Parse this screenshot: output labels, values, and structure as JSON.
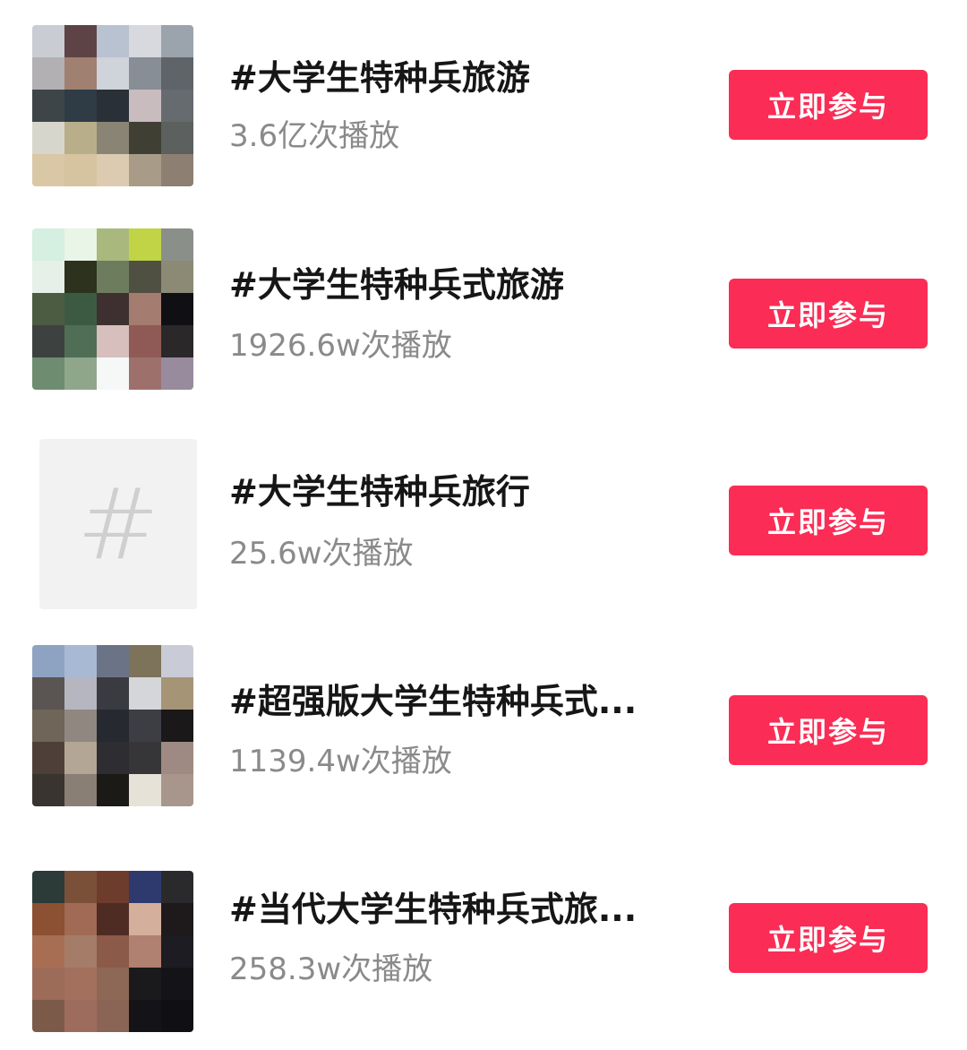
{
  "topics": [
    {
      "title": "#大学生特种兵旅游",
      "plays": "3.6亿次播放",
      "button_label": "立即参与",
      "thumb_type": "blurred-photo",
      "thumb_colors": [
        "#c9ccd3",
        "#5e4346",
        "#b9c2d0",
        "#d7d9df",
        "#9ba3ad",
        "#b2b0b3",
        "#a08070",
        "#cfd3da",
        "#878e95",
        "#5f6468",
        "#3e4549",
        "#2f3b45",
        "#2a3038",
        "#c9bcbf",
        "#666b70",
        "#d7d6cc",
        "#b9ae8a",
        "#8a8474",
        "#3f3f33",
        "#5c605e",
        "#d9c7a6",
        "#d6c39f",
        "#dccbb0",
        "#a89c88",
        "#8d7f72"
      ]
    },
    {
      "title": "#大学生特种兵式旅游",
      "plays": "1926.6w次播放",
      "button_label": "立即参与",
      "thumb_type": "blurred-photo",
      "thumb_colors": [
        "#d5efe0",
        "#e9f5e7",
        "#a9b97d",
        "#c0d446",
        "#8b8f8a",
        "#e6f0e8",
        "#2c321e",
        "#6e7c5e",
        "#505042",
        "#8c8a74",
        "#4b5c43",
        "#3c5a42",
        "#3e3030",
        "#a47c70",
        "#0f0f14",
        "#3d4240",
        "#4f6e55",
        "#d6bfbc",
        "#8f5a55",
        "#2a2828",
        "#6e8c70",
        "#8fa68b",
        "#f5f8f7",
        "#9e706c",
        "#988b9e"
      ]
    },
    {
      "title": "#大学生特种兵旅行",
      "plays": "25.6w次播放",
      "button_label": "立即参与",
      "thumb_type": "hash-placeholder",
      "thumb_colors": []
    },
    {
      "title": "#超强版大学生特种兵式...",
      "plays": "1139.4w次播放",
      "button_label": "立即参与",
      "thumb_type": "blurred-photo",
      "thumb_colors": [
        "#8ea3c2",
        "#a8b9d4",
        "#6b7486",
        "#7d735a",
        "#c9ccd6",
        "#5a5553",
        "#b5b6c0",
        "#3a3b40",
        "#d4d6da",
        "#a69476",
        "#6f6558",
        "#8f8780",
        "#262a30",
        "#3c3e44",
        "#1a1818",
        "#4e4038",
        "#b4a694",
        "#2e2e32",
        "#363638",
        "#9e8a82",
        "#3a3430",
        "#8a7f74",
        "#1c1a16",
        "#e7e2d8",
        "#a8968c"
      ]
    },
    {
      "title": "#当代大学生特种兵式旅...",
      "plays": "258.3w次播放",
      "button_label": "立即参与",
      "thumb_type": "blurred-photo",
      "thumb_colors": [
        "#2c3a38",
        "#7a5038",
        "#6e3c2c",
        "#2e3a6e",
        "#2a2a2c",
        "#8c5032",
        "#a06a54",
        "#4e2c24",
        "#d4b09c",
        "#1e1a1c",
        "#a86e54",
        "#a47c68",
        "#8c5a48",
        "#b08070",
        "#1c1c22",
        "#9c6c58",
        "#a2705c",
        "#8e6856",
        "#1a1a1c",
        "#141418",
        "#7c5a4a",
        "#9e6c5c",
        "#8a6454",
        "#141418",
        "#101014"
      ]
    }
  ],
  "colors": {
    "button_bg": "#fb2c55",
    "button_text": "#ffffff",
    "title_text": "#161616",
    "plays_text": "#8a8a8a"
  }
}
